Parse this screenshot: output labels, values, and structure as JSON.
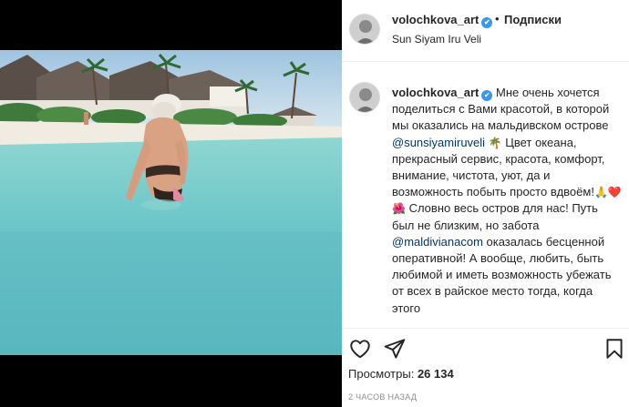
{
  "post": {
    "username": "volochkova_art",
    "verified_mark": "✔",
    "separator": "•",
    "follow_label": "Подписки",
    "location": "Sun Siyam Iru Veli"
  },
  "caption": {
    "username": "volochkova_art",
    "verified_mark": "✔",
    "part1": "Мне очень хочется поделиться с Вами красотой, в которой мы оказались на мальдивском острове ",
    "mention1": "@sunsiyamiruveli",
    "emoji1": "🌴",
    "part2": " Цвет океана, прекрасный сервис, красота, комфорт, внимание, чистота, уют, да и возможность побыть просто вдвоём!",
    "emoji2": "🙏",
    "emoji3": "❤️",
    "emoji4": "🌺",
    "part3": " Словно весь остров для нас! Путь был не близким, но забота ",
    "mention2": "@maldivianacom",
    "part4": " оказалась бесценной оперативной! А вообще, любить, быть любимой и иметь возможность убежать от всех в райское место тогда, когда этого"
  },
  "actions": {
    "like_icon": "heart-outline-icon",
    "share_icon": "paper-plane-icon",
    "save_icon": "bookmark-outline-icon"
  },
  "stats": {
    "views_label": "Просмотры:",
    "views_count": "26 134",
    "timestamp": "2 часов назад"
  },
  "colors": {
    "link": "#00376b",
    "verified": "#3897f0",
    "muted": "#8e8e8e"
  }
}
